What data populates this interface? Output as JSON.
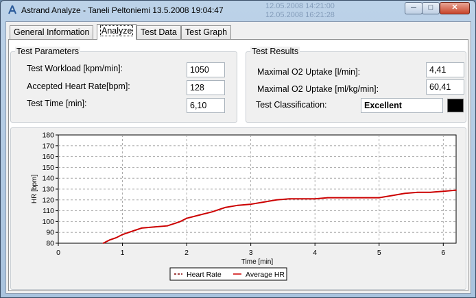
{
  "window": {
    "title": "Astrand Analyze - Taneli Peltoniemi 13.5.2008  19:04:47",
    "background_ghost": [
      "12.05.2008  14:21:00",
      "12.05.2008  16:21:28"
    ],
    "controls": {
      "minimize": "─",
      "maximize": "□",
      "close": "✕"
    }
  },
  "tabs": [
    {
      "label": "General Information",
      "active": false
    },
    {
      "label": "Analyze",
      "active": true
    },
    {
      "label": "Test Data",
      "active": false
    },
    {
      "label": "Test Graph",
      "active": false
    }
  ],
  "test_parameters": {
    "title": "Test Parameters",
    "workload_label": "Test Workload [kpm/min]:",
    "workload_value": "1050",
    "hr_label": "Accepted Heart Rate[bpm]:",
    "hr_value": "128",
    "time_label": "Test Time [min]:",
    "time_value": "6,10"
  },
  "test_results": {
    "title": "Test Results",
    "vo2_abs_label": "Maximal O2 Uptake [l/min]:",
    "vo2_abs_value": "4,41",
    "vo2_rel_label": "Maximal O2 Uptake [ml/kg/min]:",
    "vo2_rel_value": "60,41",
    "class_label": "Test Classification:",
    "class_value": "Excellent",
    "class_color": "#000000"
  },
  "chart_data": {
    "type": "line",
    "xlabel": "Time [min]",
    "ylabel": "HR [bpm]",
    "xlim": [
      0,
      6.2
    ],
    "ylim": [
      80,
      180
    ],
    "xticks": [
      0,
      1,
      2,
      3,
      4,
      5,
      6
    ],
    "yticks": [
      80,
      90,
      100,
      110,
      120,
      130,
      140,
      150,
      160,
      170,
      180
    ],
    "grid": true,
    "legend_position": "bottom-center",
    "series": [
      {
        "name": "Heart Rate",
        "color": "#800000",
        "dash": true,
        "x": [],
        "y": []
      },
      {
        "name": "Average HR",
        "color": "#cc0000",
        "dash": false,
        "x": [
          0.7,
          0.8,
          0.9,
          1.0,
          1.1,
          1.2,
          1.3,
          1.5,
          1.7,
          1.8,
          1.9,
          2.0,
          2.2,
          2.4,
          2.6,
          2.8,
          3.0,
          3.2,
          3.4,
          3.6,
          3.8,
          4.0,
          4.2,
          4.4,
          4.6,
          4.8,
          5.0,
          5.2,
          5.4,
          5.6,
          5.8,
          6.0,
          6.2
        ],
        "y": [
          80,
          83,
          85,
          88,
          90,
          92,
          94,
          95,
          96,
          98,
          100,
          103,
          106,
          109,
          113,
          115,
          116,
          118,
          120,
          121,
          121,
          121,
          122,
          122,
          122,
          122,
          122,
          124,
          126,
          127,
          127,
          128,
          129
        ]
      }
    ]
  }
}
